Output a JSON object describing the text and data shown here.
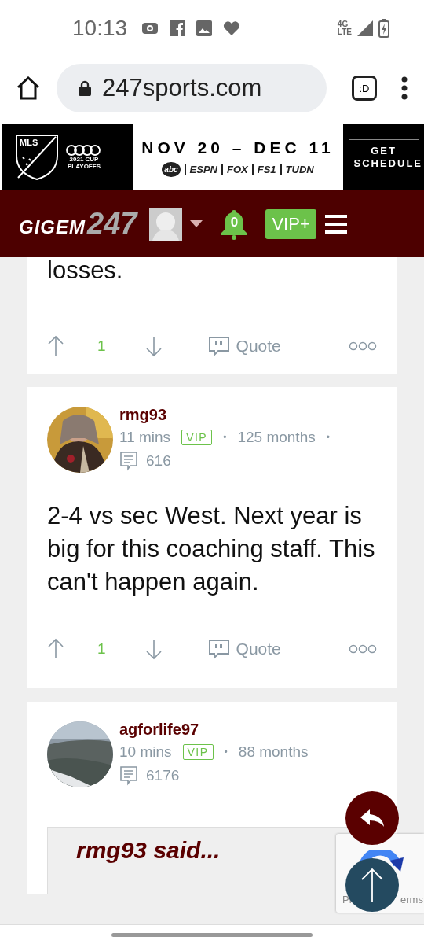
{
  "status_bar": {
    "time": "10:13",
    "network_top": "4G",
    "network_bottom": "LTE"
  },
  "browser": {
    "url": "247sports.com",
    "tabs_label": ":D"
  },
  "ad": {
    "brand": "MLS",
    "event_top": "2021 CUP",
    "event_bottom": "PLAYOFFS",
    "dates": "NOV 20 – DEC 11",
    "networks": [
      "abc",
      "ESPN",
      "FOX",
      "FS1",
      "TUDN"
    ],
    "cta": "GET SCHEDULE"
  },
  "site_header": {
    "logo_word": "GIGEM",
    "logo_number": "247",
    "notifications": "0",
    "vip": "VIP+"
  },
  "posts": [
    {
      "body": "losses.",
      "votes": "1",
      "quote": "Quote"
    },
    {
      "author": "rmg93",
      "time": "11 mins",
      "meta": [
        {
          "kind": "badge",
          "text": "VIP"
        },
        {
          "kind": "dot",
          "text": "•"
        },
        {
          "kind": "text",
          "text": "125 months"
        },
        {
          "kind": "dot",
          "text": "•"
        }
      ],
      "post_count": "616",
      "body": "2-4 vs sec West. Next year is big for this coaching staff. This can't happen again.",
      "votes": "1",
      "quote": "Quote"
    },
    {
      "author": "agforlife97",
      "time": "10 mins",
      "meta": [
        {
          "kind": "badge",
          "text": "VIP"
        },
        {
          "kind": "dot",
          "text": "•"
        },
        {
          "kind": "text",
          "text": "88 months"
        }
      ],
      "post_count": "6176",
      "quoted_header": "rmg93 said..."
    }
  ],
  "recaptcha": {
    "left_text": "Pr",
    "right_text": "erms"
  }
}
